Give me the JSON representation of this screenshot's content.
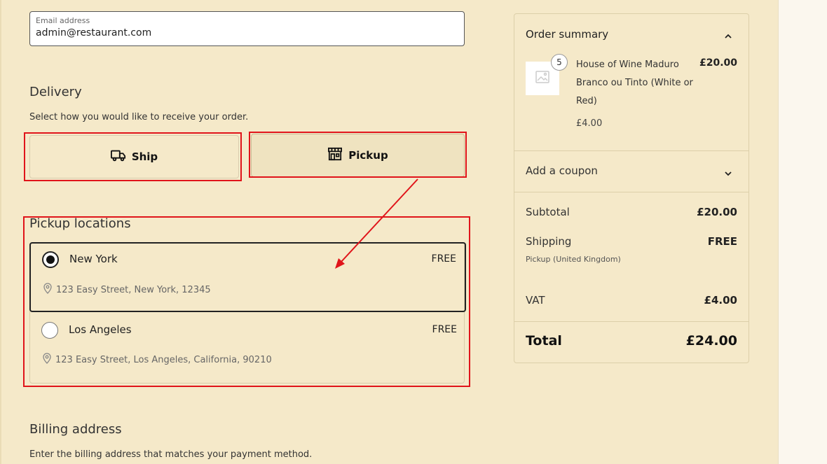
{
  "contact": {
    "email_label": "Email address",
    "email_value": "admin@restaurant.com"
  },
  "delivery": {
    "title": "Delivery",
    "description": "Select how you would like to receive your order.",
    "ship_label": "Ship",
    "pickup_label": "Pickup",
    "selected": "Pickup"
  },
  "pickup_locations": {
    "title": "Pickup locations",
    "items": [
      {
        "name": "New York",
        "price": "FREE",
        "address": "123 Easy Street, New York, 12345",
        "selected": true
      },
      {
        "name": "Los Angeles",
        "price": "FREE",
        "address": "123 Easy Street, Los Angeles, California, 90210",
        "selected": false
      }
    ]
  },
  "billing": {
    "title": "Billing address",
    "description": "Enter the billing address that matches your payment method."
  },
  "order_summary": {
    "title": "Order summary",
    "item": {
      "quantity": "5",
      "name": "House of Wine Maduro Branco ou Tinto (White or Red)",
      "total": "£20.00",
      "unit_price": "£4.00"
    },
    "coupon_label": "Add a coupon",
    "subtotal_label": "Subtotal",
    "subtotal_value": "£20.00",
    "shipping_label": "Shipping",
    "shipping_value": "FREE",
    "shipping_sub": "Pickup (United Kingdom)",
    "vat_label": "VAT",
    "vat_value": "£4.00",
    "total_label": "Total",
    "total_value": "£24.00"
  },
  "annotation": {
    "color": "#e0141a"
  }
}
